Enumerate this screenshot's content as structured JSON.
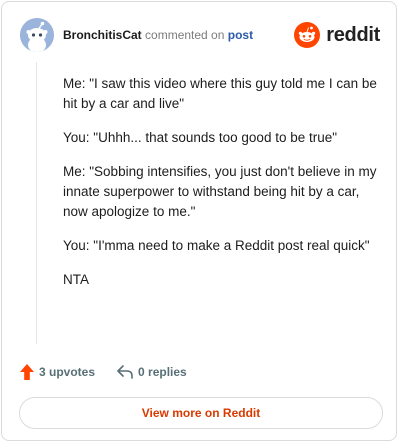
{
  "header": {
    "author": "BronchitisCat",
    "action": "commented on",
    "post_link": "post",
    "logo_text": "reddit",
    "avatar_icon": "snoo-avatar-icon",
    "logo_icon": "reddit-logo-icon"
  },
  "comment": {
    "paragraphs": [
      "Me: \"I saw this video where this guy told me I can be hit by a car and live\"",
      "You: \"Uhhh... that sounds too good to be true\"",
      "Me: \"Sobbing intensifies, you just don't believe in my innate superpower to withstand being hit by a car, now apologize to me.\"",
      "You: \"I'mma need to make a Reddit post real quick\"",
      "NTA"
    ]
  },
  "actions": {
    "upvotes": "3 upvotes",
    "replies": "0 replies",
    "upvote_icon": "upvote-arrow-icon",
    "reply_icon": "reply-icon"
  },
  "footer": {
    "view_more": "View more on Reddit"
  },
  "colors": {
    "brand": "#ff4500",
    "link": "#2a5aa8",
    "view_more_text": "#d93a00"
  }
}
